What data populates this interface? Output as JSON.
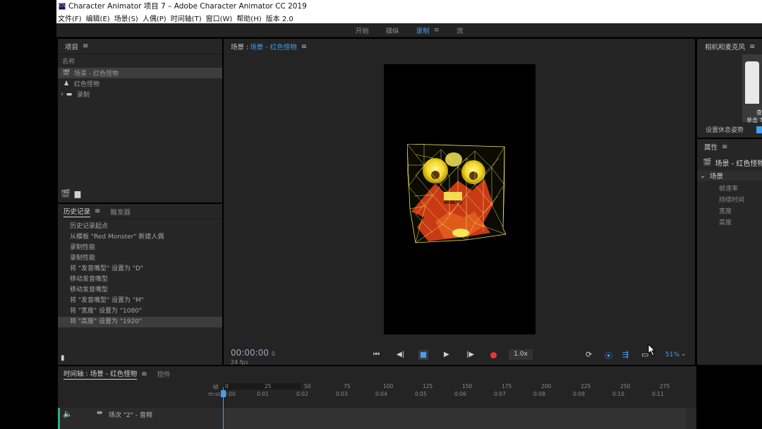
{
  "window": {
    "title": "Character Animator 项目 7 – Adobe Character Animator CC 2019",
    "icon": "Ch"
  },
  "menu": [
    "文件(F)",
    "编辑(E)",
    "场景(S)",
    "人偶(P)",
    "时间轴(T)",
    "窗口(W)",
    "帮助(H)",
    "版本 2.0"
  ],
  "workspaces": {
    "items": [
      "开始",
      "操纵",
      "录制",
      "流"
    ],
    "active": "录制",
    "menu_icon": "≡"
  },
  "project": {
    "title": "项目",
    "column": "名称",
    "items": [
      {
        "icon": "clapper-icon",
        "glyph": "🎬",
        "label": "场景 - 红色怪物",
        "selected": true
      },
      {
        "icon": "puppet-icon",
        "glyph": "♟",
        "label": "红色怪物",
        "selected": false
      },
      {
        "icon": "folder-icon",
        "glyph": "▬",
        "label": "录制",
        "selected": false,
        "expand": "›"
      }
    ]
  },
  "history": {
    "tabs": [
      "历史记录",
      "触发器"
    ],
    "items": [
      "历史记录起点",
      "从模板 \"Red Monster\" 新建人偶",
      "录制性能",
      "录制性能",
      "将 \"发音嘴型\" 设置为 \"D\"",
      "移动发音嘴型",
      "移动发音嘴型",
      "将 \"发音嘴型\" 设置为 \"M\"",
      "将 \"宽度\" 设置为 \"1080\"",
      "将 \"高度\" 设置为 \"1920\""
    ],
    "selected_index": 9
  },
  "scene": {
    "prefix": "场景 : ",
    "name": "场景 - 红色怪物",
    "timecode": "00:00:00",
    "frame": "0",
    "fps": "24 fps",
    "speed": "1.0x",
    "zoom": "51%"
  },
  "camera": {
    "title": "相机和麦克风",
    "text1": "查",
    "text2": "单击 T",
    "rest_pose": "设置休息姿势"
  },
  "properties": {
    "title": "属性",
    "scene_name": "场景 - 红色怪物",
    "section": "场景",
    "rows": [
      "帧速率",
      "持续时间",
      "宽度",
      "高度"
    ]
  },
  "timeline": {
    "tabs": [
      "时间轴 : 场景 - 红色怪物",
      "控件"
    ],
    "frame_label": "帧",
    "frame_ticks": [
      "0",
      "25",
      "50",
      "75",
      "100",
      "125",
      "150",
      "175",
      "200",
      "225",
      "250",
      "275"
    ],
    "time_label": "m:ss",
    "time_ticks": [
      "0:00",
      "0:01",
      "0:02",
      "0:03",
      "0:04",
      "0:05",
      "0:06",
      "0:07",
      "0:08",
      "0:09",
      "0:10",
      "0:11"
    ],
    "track": "场次 \"2\" - 音频"
  },
  "colors": {
    "accent": "#3fa0f5",
    "record": "#ee3333",
    "track_marker": "#29b08a"
  }
}
